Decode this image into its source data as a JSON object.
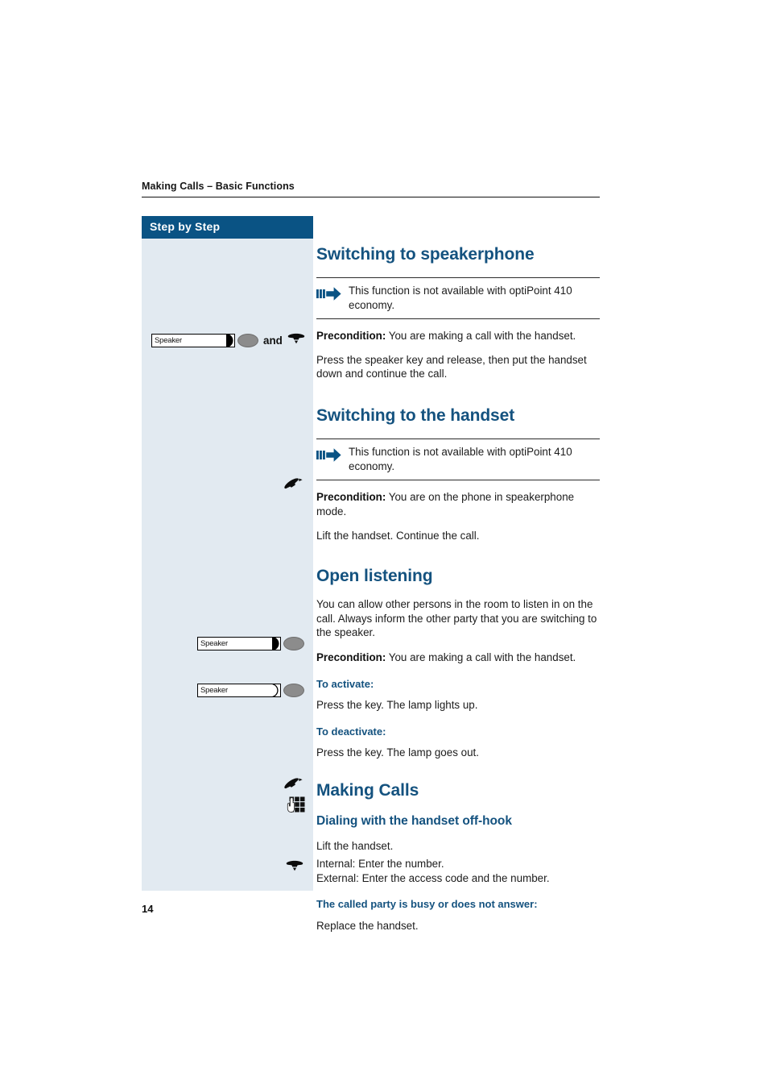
{
  "document": {
    "running_header": "Making Calls – Basic Functions",
    "page_number": "14"
  },
  "sidebar": {
    "header_label": "Step by Step",
    "background_color": "#e2eaf1",
    "header_color": "#0a5384",
    "items": [
      {
        "name": "speaker-key-and-replace-handset",
        "key_label": "Speaker",
        "lamp": "on",
        "conjunction": "and",
        "trailing_icon": "handset-on-hook-icon"
      },
      {
        "name": "lift-handset",
        "icon": "handset-lift-icon"
      },
      {
        "name": "speaker-key-activate",
        "key_label": "Speaker",
        "lamp": "on"
      },
      {
        "name": "speaker-key-deactivate",
        "key_label": "Speaker",
        "lamp": "off"
      },
      {
        "name": "lift-handset-dial",
        "icon": "handset-lift-icon"
      },
      {
        "name": "enter-number-keypad",
        "icon": "keypad-icon"
      },
      {
        "name": "replace-handset",
        "icon": "handset-on-hook-icon"
      }
    ]
  },
  "colors": {
    "heading_blue": "#14527f",
    "header_bar_blue": "#0a5384",
    "sidebar_blue": "#e2eaf1",
    "arrow_icon_blue": "#0a5384"
  },
  "content": {
    "section_1": {
      "title": "Switching to speakerphone",
      "note": "This function is not available with optiPoint 410 economy.",
      "precondition_label": "Precondition:",
      "precondition_text": " You are making a call with the handset.",
      "instruction": "Press the speaker key and release, then put the handset down and continue the call."
    },
    "section_2": {
      "title": "Switching to the handset",
      "note": "This function is not available with optiPoint 410 economy.",
      "precondition_label": "Precondition:",
      "precondition_text": " You are on the phone in speakerphone mode.",
      "instruction": "Lift the handset. Continue the call."
    },
    "section_3": {
      "title": "Open listening",
      "intro": "You can allow other persons in the room to listen in on the call. Always inform the other party that you are switching to the speaker.",
      "precondition_label": "Precondition:",
      "precondition_text": " You are making a call with the handset.",
      "activate_heading": "To activate:",
      "activate_text": "Press the key. The lamp lights up.",
      "deactivate_heading": "To deactivate:",
      "deactivate_text": "Press the key. The lamp goes out."
    },
    "section_4": {
      "title": "Making Calls",
      "subtitle": "Dialing with the handset off-hook",
      "step_lift": "Lift the handset.",
      "step_enter_internal": "Internal: Enter the number.",
      "step_enter_external": "External: Enter the access code and the number.",
      "busy_heading": "The called party is busy or does not answer:",
      "busy_text": "Replace the handset."
    }
  }
}
